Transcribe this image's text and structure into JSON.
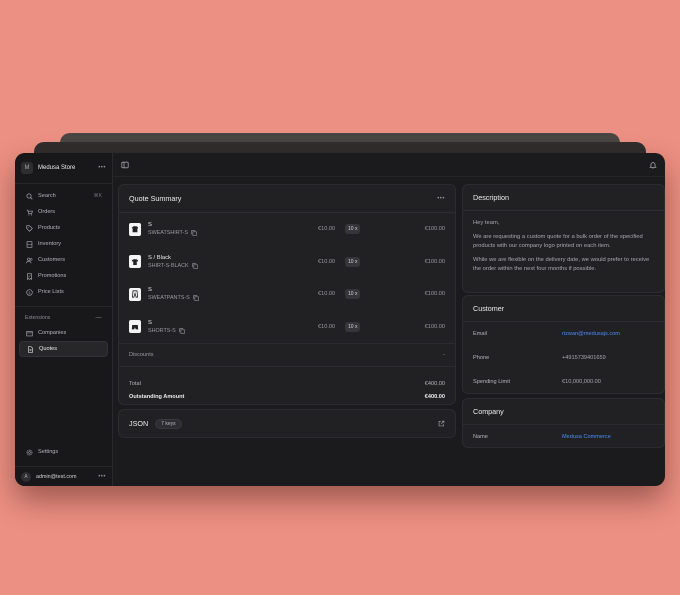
{
  "sidebar": {
    "store_initial": "M",
    "store_name": "Medusa Store",
    "search": {
      "label": "Search",
      "shortcut": "⌘K"
    },
    "nav": [
      {
        "label": "Orders",
        "icon": "shopping-cart-icon"
      },
      {
        "label": "Products",
        "icon": "tag-icon"
      },
      {
        "label": "Inventory",
        "icon": "building-icon"
      },
      {
        "label": "Customers",
        "icon": "users-icon"
      },
      {
        "label": "Promotions",
        "icon": "receipt-percent-icon"
      },
      {
        "label": "Price Lists",
        "icon": "currency-dollar-icon"
      }
    ],
    "extensions_label": "Extensions",
    "extensions": [
      {
        "label": "Companies",
        "icon": "building-storefront-icon"
      },
      {
        "label": "Quotes",
        "icon": "document-icon",
        "active": true
      }
    ],
    "settings_label": "Settings",
    "user_initial": "A",
    "user_email": "admin@test.com"
  },
  "quote_summary": {
    "title": "Quote Summary",
    "items": [
      {
        "title": "S",
        "sku": "SWEATSHIRT-S",
        "unit_price": "€10.00",
        "qty": "10 x",
        "total": "€100.00",
        "icon": "sweatshirt-icon"
      },
      {
        "title": "S / Black",
        "sku": "SHIRT-S-BLACK",
        "unit_price": "€10.00",
        "qty": "10 x",
        "total": "€100.00",
        "icon": "tshirt-icon"
      },
      {
        "title": "S",
        "sku": "SWEATPANTS-S",
        "unit_price": "€10.00",
        "qty": "10 x",
        "total": "€100.00",
        "icon": "sweatpants-icon"
      },
      {
        "title": "S",
        "sku": "SHORTS-S",
        "unit_price": "€10.00",
        "qty": "10 x",
        "total": "€100.00",
        "icon": "shorts-icon"
      }
    ],
    "discounts_label": "Discounts",
    "discounts_value": "-",
    "total_label": "Total",
    "total_value": "€400.00",
    "outstanding_label": "Outstanding Amount",
    "outstanding_value": "€400.00"
  },
  "json_section": {
    "title": "JSON",
    "badge": "7 keys"
  },
  "description": {
    "title": "Description",
    "paragraphs": [
      "Hey team,",
      "We are requesting a custom quote for a bulk order of the specified products with our company logo printed on each item.",
      "While we are flexible on the delivery date, we would prefer to receive the order within the next four months if possible."
    ]
  },
  "customer": {
    "title": "Customer",
    "email_label": "Email",
    "email": "rizwan@medusajs.com",
    "phone_label": "Phone",
    "phone": "+4915739401659",
    "limit_label": "Spending Limit",
    "limit": "€10,000,000.00"
  },
  "company": {
    "title": "Company",
    "name_label": "Name",
    "name": "Medusa Commerce"
  },
  "colors": {
    "background": "#ec9083",
    "window": "#1b1b1d",
    "link": "#4a8cf7"
  }
}
